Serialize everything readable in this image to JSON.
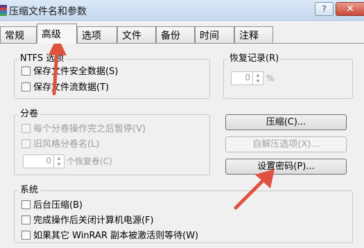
{
  "window": {
    "title": "压缩文件名和参数",
    "help_label": "?",
    "close_label": "✕"
  },
  "tabs": [
    {
      "label": "常规"
    },
    {
      "label": "高级"
    },
    {
      "label": "选项"
    },
    {
      "label": "文件"
    },
    {
      "label": "备份"
    },
    {
      "label": "时间"
    },
    {
      "label": "注释"
    }
  ],
  "ntfs": {
    "title": "NTFS 选项",
    "options": [
      {
        "label": "保存文件安全数据(S)",
        "checked": false
      },
      {
        "label": "保存文件流数据(T)",
        "checked": false
      }
    ]
  },
  "recovery": {
    "title": "恢复记录(R)",
    "value": "0",
    "unit": "%"
  },
  "split": {
    "title": "分卷",
    "options": [
      {
        "label": "每个分卷操作完之后暂停(V)",
        "checked": false
      },
      {
        "label": "旧风格分卷名(L)",
        "checked": false
      }
    ],
    "recovery_value": "0",
    "recovery_label": "个恢复卷(C)"
  },
  "buttons": {
    "compress": "压缩(C)...",
    "sfx": "自解压选项(X)...",
    "password": "设置密码(P)..."
  },
  "system": {
    "title": "系统",
    "options": [
      {
        "label": "后台压缩(B)",
        "checked": false
      },
      {
        "label": "完成操作后关闭计算机电源(F)",
        "checked": false
      },
      {
        "label": "如果其它 WinRAR 副本被激活则等待(W)",
        "checked": false
      }
    ]
  },
  "colors": {
    "annotation_arrow": "#e0523f"
  }
}
